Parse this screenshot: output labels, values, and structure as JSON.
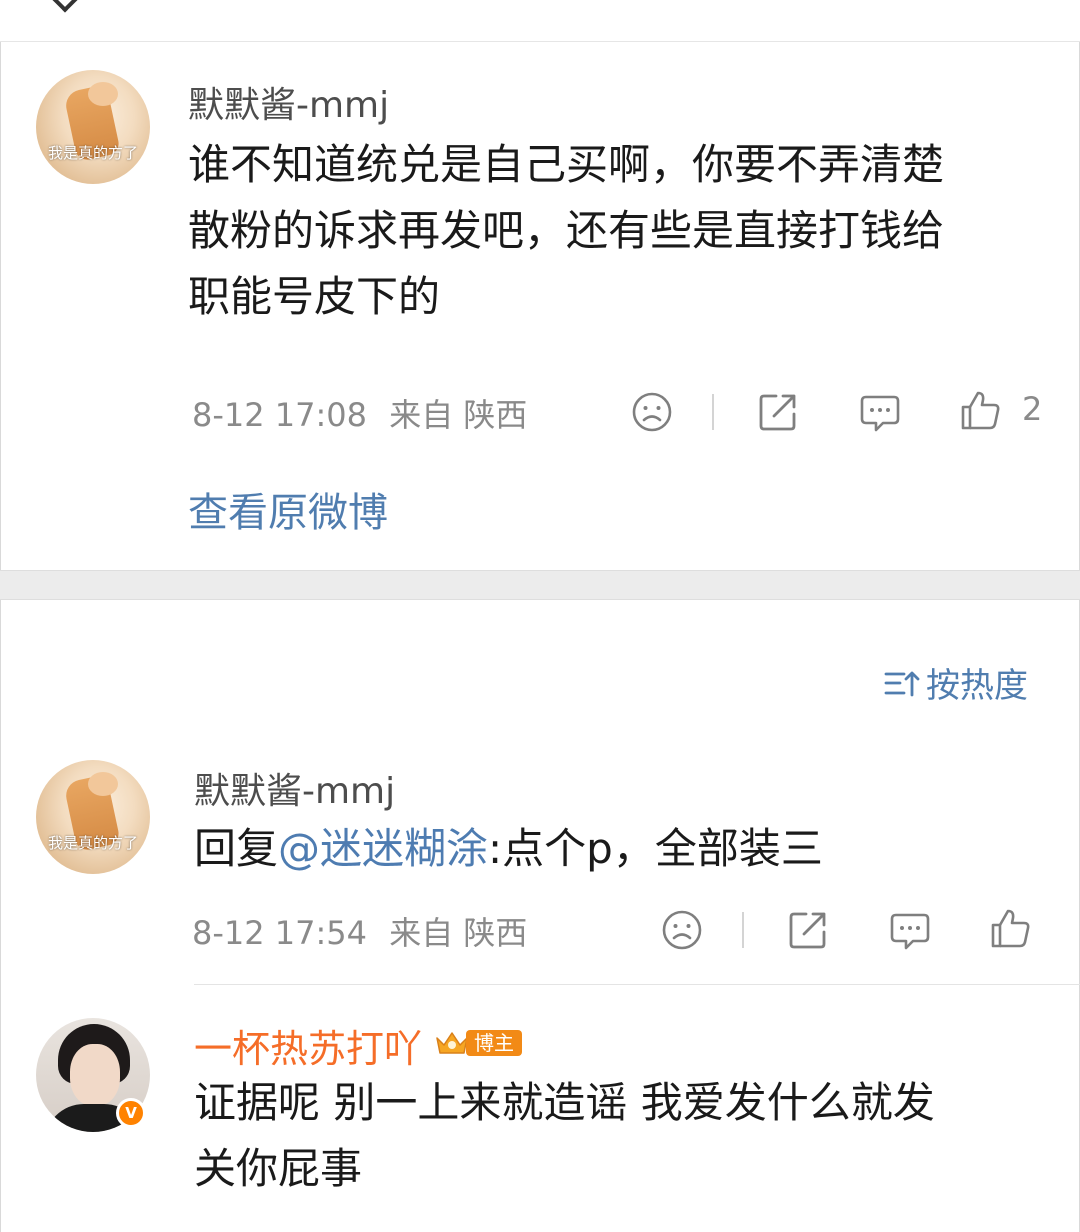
{
  "post": {
    "username": "默默酱-mmj",
    "avatar_text": "我是真的方了",
    "text_lines": [
      "谁不知道统兑是自己买啊，你要不弄清楚",
      "散粉的诉求再发吧，还有些是直接打钱给",
      "职能号皮下的"
    ],
    "timestamp": "8-12 17:08",
    "source": "来自 陕西",
    "like_count": "2",
    "view_original": "查看原微博"
  },
  "sort": {
    "label": "按热度"
  },
  "comments": [
    {
      "username": "默默酱-mmj",
      "avatar_text": "我是真的方了",
      "reply_prefix": "回复",
      "mention": "@迷迷糊涂",
      "reply_text": ":点个p，全部装三",
      "timestamp": "8-12 17:54",
      "source": "来自 陕西"
    },
    {
      "username": "一杯热苏打吖",
      "badge": "博主",
      "verified_mark": "V",
      "text_lines": [
        "证据呢 别一上来就造谣  我爱发什么就发",
        "关你屁事"
      ]
    }
  ],
  "colors": {
    "link_blue": "#507daf",
    "orange": "#f56d28",
    "meta_gray": "#8a8a8a"
  }
}
